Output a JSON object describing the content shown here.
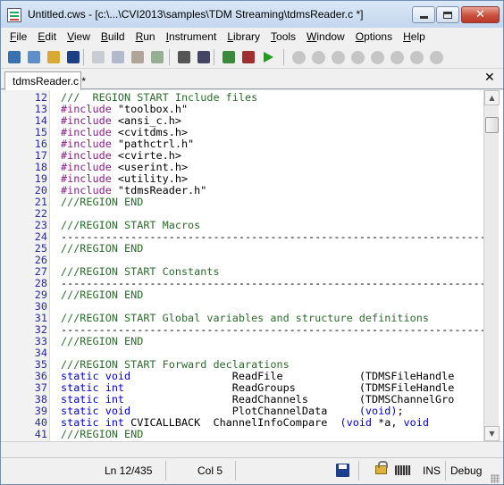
{
  "window": {
    "title": "Untitled.cws - [c:\\...\\CVI2013\\samples\\TDM Streaming\\tdmsReader.c *]",
    "min_glyph": "",
    "close_glyph": "✕"
  },
  "menu": [
    {
      "label": "File",
      "key": "F",
      "rest": "ile"
    },
    {
      "label": "Edit",
      "key": "E",
      "rest": "dit"
    },
    {
      "label": "View",
      "key": "V",
      "rest": "iew"
    },
    {
      "label": "Build",
      "key": "B",
      "rest": "uild"
    },
    {
      "label": "Run",
      "key": "R",
      "rest": "un"
    },
    {
      "label": "Instrument",
      "key": "I",
      "rest": "nstrument"
    },
    {
      "label": "Library",
      "key": "L",
      "rest": "ibrary"
    },
    {
      "label": "Tools",
      "key": "T",
      "rest": "ools"
    },
    {
      "label": "Window",
      "key": "W",
      "rest": "indow"
    },
    {
      "label": "Options",
      "key": "O",
      "rest": "ptions"
    },
    {
      "label": "Help",
      "key": "H",
      "rest": "elp"
    }
  ],
  "toolbar": {
    "icons": [
      "workspace-icon",
      "new-icon",
      "open-icon",
      "save-icon",
      "cut-icon",
      "copy-icon",
      "paste-icon",
      "undo-icon",
      "find-icon",
      "find-replace-icon",
      "build-icon",
      "stop-build-icon",
      "run-icon",
      "breakpoint-icon",
      "step-into-icon",
      "step-over-icon",
      "step-out-icon",
      "continue-icon",
      "go-icon",
      "terminate-icon",
      "disable-icon"
    ],
    "debug_glyphs": [
      "{}",
      "{}",
      "{}",
      "{}",
      "{}",
      "STOP",
      "STOP"
    ]
  },
  "tab": {
    "label": "tdmsReader.c *",
    "close_glyph": "✕"
  },
  "code": [
    {
      "n": "12",
      "parts": [
        {
          "t": "///  REGION START Include files",
          "c": "comment"
        }
      ]
    },
    {
      "n": "13",
      "parts": [
        {
          "t": "#include",
          "c": "pp"
        },
        {
          "t": " \"toolbox.h\"",
          "c": "str"
        }
      ]
    },
    {
      "n": "14",
      "parts": [
        {
          "t": "#include",
          "c": "pp"
        },
        {
          "t": " <ansi_c.h>",
          "c": "str"
        }
      ]
    },
    {
      "n": "15",
      "parts": [
        {
          "t": "#include",
          "c": "pp"
        },
        {
          "t": " <cvitdms.h>",
          "c": "str"
        }
      ]
    },
    {
      "n": "16",
      "parts": [
        {
          "t": "#include",
          "c": "pp"
        },
        {
          "t": " \"pathctrl.h\"",
          "c": "str"
        }
      ]
    },
    {
      "n": "17",
      "parts": [
        {
          "t": "#include",
          "c": "pp"
        },
        {
          "t": " <cvirte.h>",
          "c": "str"
        }
      ]
    },
    {
      "n": "18",
      "parts": [
        {
          "t": "#include",
          "c": "pp"
        },
        {
          "t": " <userint.h>",
          "c": "str"
        }
      ]
    },
    {
      "n": "19",
      "parts": [
        {
          "t": "#include",
          "c": "pp"
        },
        {
          "t": " <utility.h>",
          "c": "str"
        }
      ]
    },
    {
      "n": "20",
      "parts": [
        {
          "t": "#include",
          "c": "pp"
        },
        {
          "t": " \"tdmsReader.h\"",
          "c": "str"
        }
      ]
    },
    {
      "n": "21",
      "parts": [
        {
          "t": "///REGION END",
          "c": "comment"
        }
      ]
    },
    {
      "n": "22",
      "parts": []
    },
    {
      "n": "23",
      "parts": [
        {
          "t": "///REGION START Macros",
          "c": "comment"
        }
      ]
    },
    {
      "n": "24",
      "parts": [
        {
          "t": "-------------------------------------------------------------------------------",
          "c": "plain"
        }
      ]
    },
    {
      "n": "25",
      "parts": [
        {
          "t": "///REGION END",
          "c": "comment"
        }
      ]
    },
    {
      "n": "26",
      "parts": []
    },
    {
      "n": "27",
      "parts": [
        {
          "t": "///REGION START Constants",
          "c": "comment"
        }
      ]
    },
    {
      "n": "28",
      "parts": [
        {
          "t": "-------------------------------------------------------------------------------",
          "c": "plain"
        }
      ]
    },
    {
      "n": "29",
      "parts": [
        {
          "t": "///REGION END",
          "c": "comment"
        }
      ]
    },
    {
      "n": "30",
      "parts": []
    },
    {
      "n": "31",
      "parts": [
        {
          "t": "///REGION START Global variables and structure definitions",
          "c": "comment"
        }
      ]
    },
    {
      "n": "32",
      "parts": [
        {
          "t": "-------------------------------------------------------------------------------",
          "c": "plain"
        }
      ]
    },
    {
      "n": "33",
      "parts": [
        {
          "t": "///REGION END",
          "c": "comment"
        }
      ]
    },
    {
      "n": "34",
      "parts": []
    },
    {
      "n": "35",
      "parts": [
        {
          "t": "///REGION START Forward declarations",
          "c": "comment"
        }
      ]
    },
    {
      "n": "36",
      "parts": [
        {
          "t": "static void",
          "c": "kw"
        },
        {
          "t": "                ReadFile            (TDMSFileHandle",
          "c": "plain"
        }
      ]
    },
    {
      "n": "37",
      "parts": [
        {
          "t": "static int",
          "c": "kw"
        },
        {
          "t": "                 ReadGroups          (TDMSFileHandle",
          "c": "plain"
        }
      ]
    },
    {
      "n": "38",
      "parts": [
        {
          "t": "static int",
          "c": "kw"
        },
        {
          "t": "                 ReadChannels        (TDMSChannelGro",
          "c": "plain"
        }
      ]
    },
    {
      "n": "39",
      "parts": [
        {
          "t": "static void",
          "c": "kw"
        },
        {
          "t": "                PlotChannelData     ",
          "c": "plain"
        },
        {
          "t": "(void)",
          "c": "kw"
        },
        {
          "t": ";",
          "c": "plain"
        }
      ]
    },
    {
      "n": "40",
      "parts": [
        {
          "t": "static int",
          "c": "kw"
        },
        {
          "t": " CVICALLBACK  ChannelInfoCompare  ",
          "c": "plain"
        },
        {
          "t": "(void",
          "c": "kw"
        },
        {
          "t": " *a, ",
          "c": "plain"
        },
        {
          "t": "void",
          "c": "kw"
        }
      ]
    },
    {
      "n": "41",
      "parts": [
        {
          "t": "///REGION END",
          "c": "comment"
        }
      ]
    }
  ],
  "status": {
    "position": "Ln 12/435",
    "column": "Col 5",
    "insert_mode": "INS",
    "config": "Debug"
  }
}
